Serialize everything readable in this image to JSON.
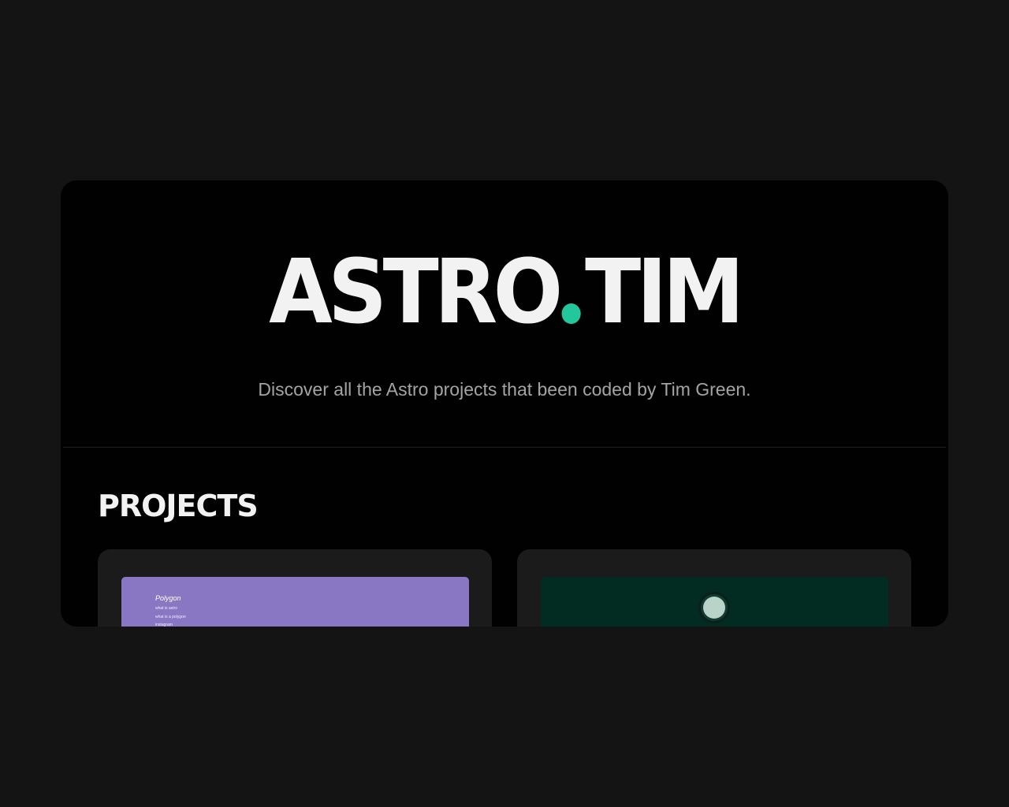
{
  "brand": {
    "logo_left": "ASTRO",
    "logo_right": "TIM",
    "dot_color": "#22c79b"
  },
  "hero": {
    "tagline": "Discover all the Astro projects that been coded by Tim Green."
  },
  "projects": {
    "title": "PROJECTS",
    "cards": [
      {
        "thumb_title": "Polygon",
        "links": [
          "what is astro",
          "what is a polygon",
          "instagram"
        ],
        "thumb_color": "#8a77c3"
      },
      {
        "thumb_color": "#022b22",
        "avatar_icon": "avatar-icon"
      }
    ]
  }
}
